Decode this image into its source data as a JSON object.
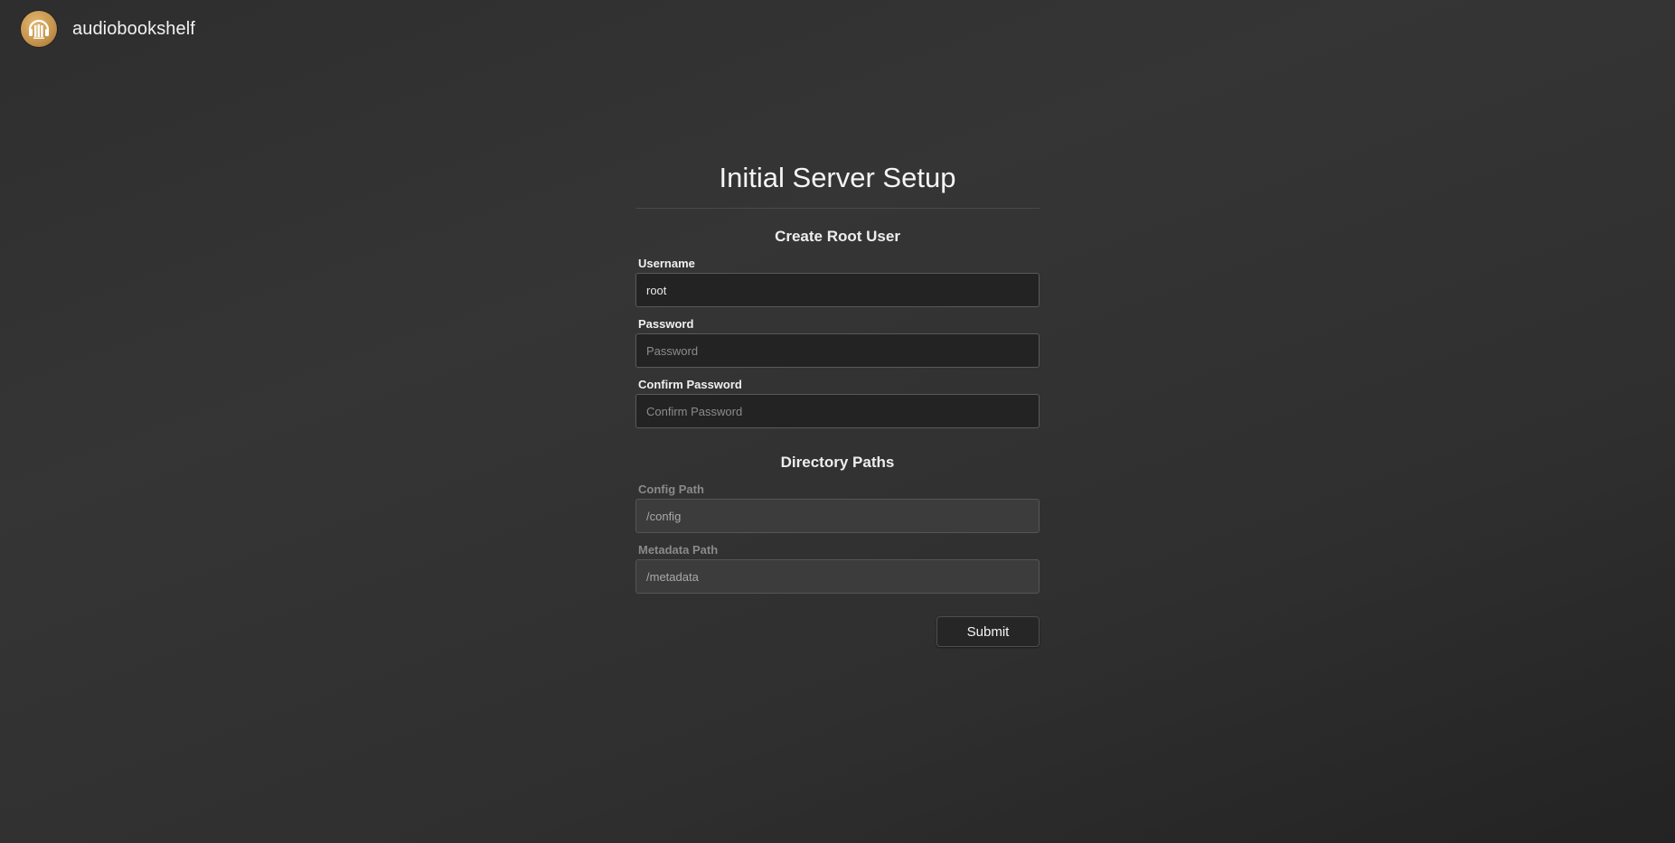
{
  "app": {
    "name": "audiobookshelf",
    "logo_icon": "headphones-books-logo"
  },
  "setup": {
    "title": "Initial Server Setup",
    "root_user": {
      "section_title": "Create Root User",
      "username": {
        "label": "Username",
        "value": "root",
        "placeholder": ""
      },
      "password": {
        "label": "Password",
        "value": "",
        "placeholder": "Password"
      },
      "confirm_password": {
        "label": "Confirm Password",
        "value": "",
        "placeholder": "Confirm Password"
      }
    },
    "directory_paths": {
      "section_title": "Directory Paths",
      "config_path": {
        "label": "Config Path",
        "value": "/config"
      },
      "metadata_path": {
        "label": "Metadata Path",
        "value": "/metadata"
      }
    },
    "submit_label": "Submit"
  },
  "colors": {
    "accent_logo": "#c8964e",
    "background": "#333333"
  }
}
